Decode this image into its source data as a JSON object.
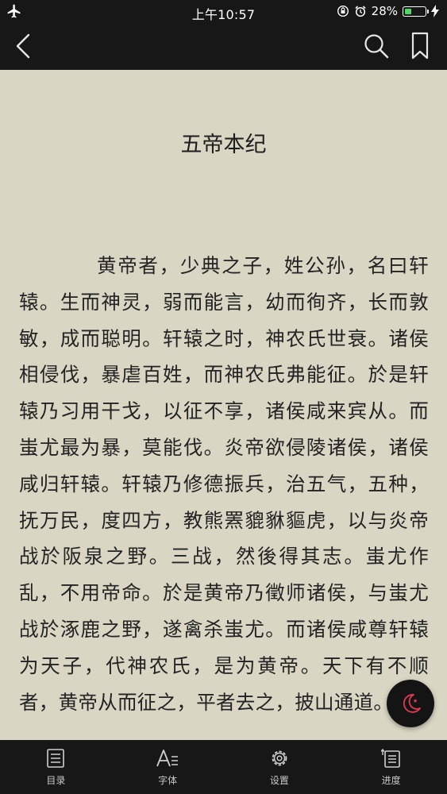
{
  "status_bar": {
    "time": "上午10:57",
    "battery_percent": "28%",
    "battery_level": 0.28
  },
  "chapter": {
    "title": "五帝本纪",
    "text": "黄帝者，少典之子，姓公孙，名曰轩辕。生而神灵，弱而能言，幼而徇齐，长而敦敏，成而聪明。轩辕之时，神农氏世衰。诸侯相侵伐，暴虐百姓，而神农氏弗能征。於是轩辕乃习用干戈，以征不享，诸侯咸来宾从。而蚩尤最为暴，莫能伐。炎帝欲侵陵诸侯，诸侯咸归轩辕。轩辕乃修德振兵，治五气，五种，抚万民，度四方，教熊罴貔貅貙虎，以与炎帝战於阪泉之野。三战，然後得其志。蚩尤作乱，不用帝命。於是黄帝乃徵师诸侯，与蚩尤战於涿鹿之野，遂禽杀蚩尤。而诸侯咸尊轩辕为天子，代神农氏，是为黄帝。天下有不顺者，黄帝从而征之，平者去之，披山通道。"
  },
  "toolbar": {
    "items": [
      {
        "label": "目录",
        "icon": "list-icon"
      },
      {
        "label": "字体",
        "icon": "font-icon"
      },
      {
        "label": "设置",
        "icon": "gear-icon"
      },
      {
        "label": "进度",
        "icon": "progress-icon"
      }
    ]
  },
  "colors": {
    "page_background": "#dad6c4",
    "bar_background": "#171717",
    "night_moon": "#e03a52"
  }
}
